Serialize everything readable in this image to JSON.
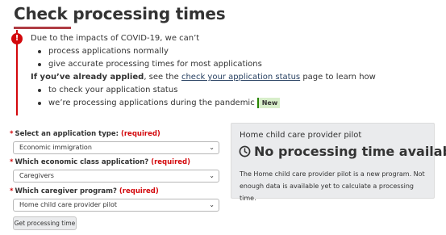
{
  "page": {
    "title": "Check processing times"
  },
  "alert": {
    "icon": "!",
    "intro": "Due to the impacts of COVID-19, we can’t",
    "bullets1": [
      "process applications normally",
      "give accurate processing times for most applications"
    ],
    "applied_bold": "If you’ve already applied",
    "applied_pre": ", see the ",
    "applied_link": "check your application status",
    "applied_post": " page to learn how",
    "bullets2": [
      "to check your application status",
      "we’re processing applications during the pandemic"
    ],
    "badge": "New"
  },
  "form": {
    "required_mark": "*",
    "fields": [
      {
        "label": "Select an application type:",
        "required": "(required)",
        "value": "Economic immigration"
      },
      {
        "label": "Which economic class application?",
        "required": "(required)",
        "value": "Caregivers"
      },
      {
        "label": "Which caregiver program?",
        "required": "(required)",
        "value": "Home child care provider pilot"
      }
    ],
    "submit_label": "Get processing time"
  },
  "result": {
    "title": "Home child care provider pilot",
    "headline": "No processing time available",
    "icon": "clock-icon",
    "description": "The Home child care provider pilot is a new program. Not enough data is available yet to calculate a processing time."
  },
  "colors": {
    "accent_red": "#d3080c",
    "title_rule": "#af3c43",
    "link": "#284162",
    "badge_bg": "#d8eeca"
  }
}
